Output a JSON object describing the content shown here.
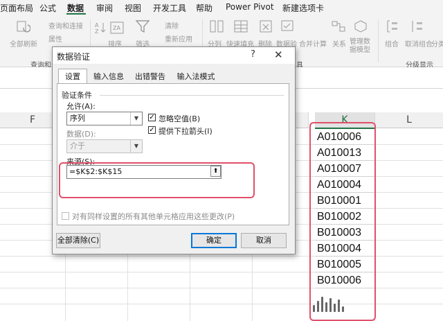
{
  "ribbon": {
    "tabs": [
      "页面布局",
      "公式",
      "数据",
      "审阅",
      "视图",
      "开发工具",
      "帮助",
      "Power Pivot",
      "新建选项卡"
    ],
    "active_tab": "数据",
    "items": [
      "全部刷新",
      "查询和连接",
      "属性",
      "排序",
      "筛选",
      "清除",
      "重新应用",
      "分列",
      "快速填充",
      "删除",
      "数据验",
      "合并计算",
      "关系",
      "管理数据模型",
      "组合",
      "取消组合",
      "分类汇"
    ],
    "groups": [
      "查询和连",
      "工具",
      "分级显示"
    ]
  },
  "sheet": {
    "columns": [
      "F",
      "K",
      "L"
    ],
    "k_values": [
      "A010006",
      "A010013",
      "A010007",
      "A010004",
      "B010001",
      "B010002",
      "B010003",
      "B010004",
      "B010005",
      "B010006"
    ]
  },
  "dialog": {
    "title": "数据验证",
    "help": "?",
    "close": "✕",
    "tabs": [
      "设置",
      "输入信息",
      "出错警告",
      "输入法模式"
    ],
    "section": "验证条件",
    "allow_label": "允许(A):",
    "allow_value": "序列",
    "data_label": "数据(D):",
    "data_value": "介于",
    "ignore_blank": "忽略空值(B)",
    "dropdown": "提供下拉箭头(I)",
    "source_label": "来源(S):",
    "source_value": "=$K$2:$K$15",
    "apply_all": "对有同样设置的所有其他单元格应用这些更改(P)",
    "clear_btn": "全部清除(C)",
    "ok_btn": "确定",
    "cancel_btn": "取消"
  },
  "colors": {
    "highlight": "#e0506a",
    "accent": "#217346",
    "ok_border": "#0078d7"
  }
}
